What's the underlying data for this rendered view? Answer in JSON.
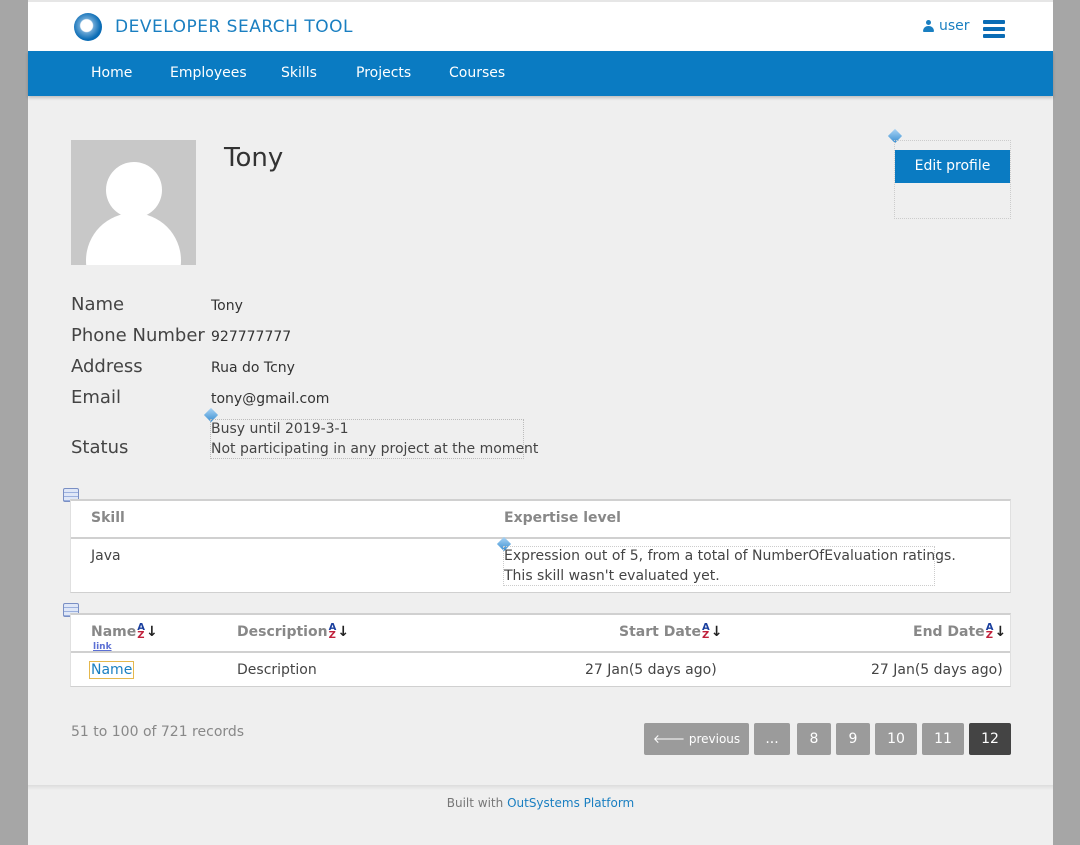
{
  "app": {
    "brand": "DEVELOPER SEARCH TOOL",
    "user_label": "user"
  },
  "nav": {
    "items": [
      "Home",
      "Employees",
      "Skills",
      "Projects",
      "Courses"
    ]
  },
  "profile": {
    "name": "Tony",
    "edit_label": "Edit profile",
    "fields": [
      {
        "label": "Name",
        "value": "Tony"
      },
      {
        "label": "Phone Number",
        "value": "927777777"
      },
      {
        "label": "Address",
        "value": "Rua do Tcny"
      },
      {
        "label": "Email",
        "value": "tony@gmail.com"
      }
    ],
    "status_label": "Status",
    "status_lines": [
      "Busy until 2019-3-1",
      "Not participating in any project at the moment"
    ]
  },
  "skills_table": {
    "headers": [
      "Skill",
      "Expertise level"
    ],
    "rows": [
      {
        "skill": "Java",
        "expertise_line1": "Expression out of 5, from a total of NumberOfEvaluation ratings.",
        "expertise_line2": "This skill wasn't evaluated yet."
      }
    ]
  },
  "projects_table": {
    "headers": [
      "Name",
      "Description",
      "Start Date",
      "End Date"
    ],
    "link_tag": "link",
    "rows": [
      {
        "name": "Name",
        "description": "Description",
        "start": "27 Jan(5 days ago)",
        "end": "27 Jan(5 days ago)"
      }
    ]
  },
  "pagination": {
    "records_text": "51 to 100 of 721 records",
    "previous_label": "previous",
    "ellipsis": "...",
    "pages": [
      "8",
      "9",
      "10",
      "11",
      "12"
    ],
    "active_page": "12"
  },
  "footer": {
    "prefix": "Built with",
    "link": "OutSystems Platform"
  },
  "colors": {
    "accent": "#0a7bc2",
    "background": "#efefef",
    "active_page": "#444444"
  }
}
